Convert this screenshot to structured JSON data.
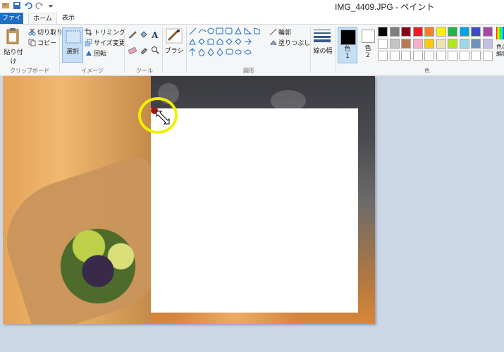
{
  "window": {
    "title": "IMG_4409.JPG - ペイント"
  },
  "tabs": {
    "file": "ファイル",
    "home": "ホーム",
    "view": "表示"
  },
  "clipboard": {
    "paste": "貼り付け",
    "cut": "切り取り",
    "copy": "コピー",
    "group": "クリップボード"
  },
  "image": {
    "select": "選択",
    "crop": "トリミング",
    "resize": "サイズ変更",
    "rotate": "回転",
    "group": "イメージ"
  },
  "tools": {
    "group": "ツール"
  },
  "brushes": {
    "label": "ブラシ"
  },
  "shapes": {
    "outline": "輪郭",
    "fill": "塗りつぶし",
    "group": "図形"
  },
  "size": {
    "label": "線の幅"
  },
  "colors": {
    "color1": "色\n1",
    "color2": "色\n2",
    "edit": "色の\n編集",
    "group": "色",
    "palette": [
      "#000000",
      "#7f7f7f",
      "#880015",
      "#ed1c24",
      "#ff7f27",
      "#fff200",
      "#22b14c",
      "#00a2e8",
      "#3f48cc",
      "#a349a4",
      "#ffffff",
      "#c3c3c3",
      "#b97a57",
      "#ffaec9",
      "#ffc90e",
      "#efe4b0",
      "#b5e61d",
      "#99d9ea",
      "#7092be",
      "#c8bfe7"
    ]
  }
}
